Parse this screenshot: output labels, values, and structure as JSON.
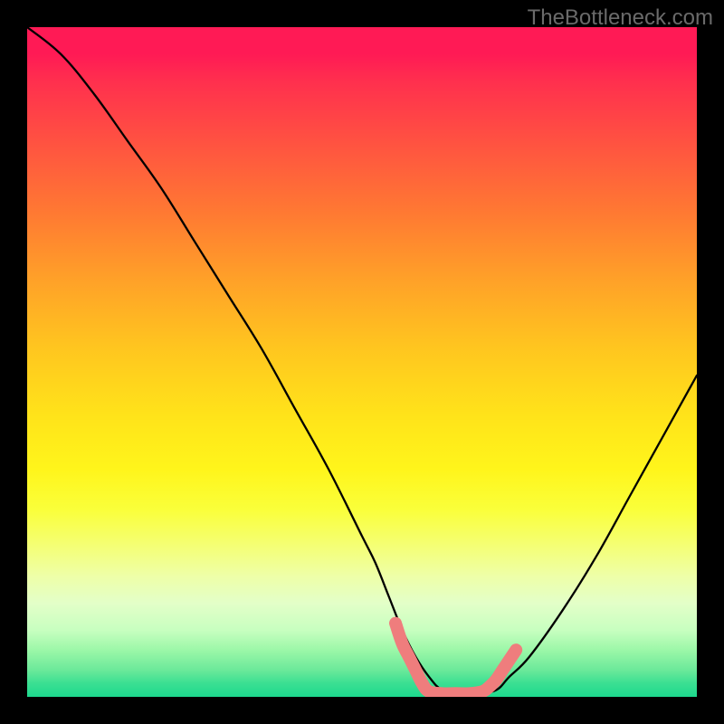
{
  "watermark": "TheBottleneck.com",
  "chart_data": {
    "type": "line",
    "title": "",
    "xlabel": "",
    "ylabel": "",
    "xlim": [
      0,
      100
    ],
    "ylim": [
      0,
      100
    ],
    "grid": false,
    "series": [
      {
        "name": "bottleneck-curve",
        "color": "#000000",
        "x": [
          0,
          5,
          10,
          15,
          20,
          25,
          30,
          35,
          40,
          45,
          50,
          52,
          54,
          56,
          58,
          60,
          62,
          65,
          67,
          70,
          72,
          75,
          80,
          85,
          90,
          95,
          100
        ],
        "values": [
          100,
          96,
          90,
          83,
          76,
          68,
          60,
          52,
          43,
          34,
          24,
          20,
          15,
          10,
          6,
          3,
          1,
          0.5,
          0.5,
          1,
          3,
          6,
          13,
          21,
          30,
          39,
          48
        ]
      }
    ],
    "annotations": [
      {
        "name": "trough-highlight",
        "color": "#ef7d7d",
        "x": [
          55,
          56,
          57,
          58,
          59,
          60,
          62,
          64,
          66,
          68,
          69,
          70,
          71,
          72,
          73
        ],
        "values": [
          11,
          8,
          6,
          4,
          2,
          0.8,
          0.5,
          0.5,
          0.5,
          0.8,
          1.5,
          2.5,
          4,
          5.5,
          7
        ]
      }
    ]
  }
}
